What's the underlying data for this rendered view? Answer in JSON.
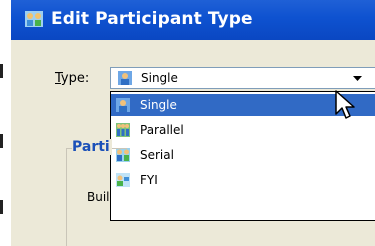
{
  "window": {
    "title": "Edit Participant Type"
  },
  "form": {
    "type_label_prefix": "",
    "type_label_underlined": "T",
    "type_label_rest": "ype:",
    "selected_value": "Single",
    "group_label": "Parti",
    "build_label": "Buil"
  },
  "dropdown": {
    "options": [
      {
        "label": "Single",
        "icon": "single-participant-icon",
        "selected": true
      },
      {
        "label": "Parallel",
        "icon": "parallel-participant-icon",
        "selected": false
      },
      {
        "label": "Serial",
        "icon": "serial-participant-icon",
        "selected": false
      },
      {
        "label": "FYI",
        "icon": "fyi-participant-icon",
        "selected": false
      }
    ]
  },
  "colors": {
    "titlebar": "#0e52d0",
    "selection": "#316ac5",
    "group_label": "#1b50b8"
  }
}
